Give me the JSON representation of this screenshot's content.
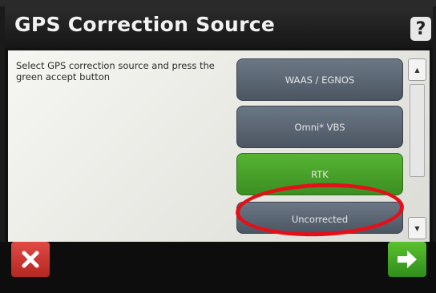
{
  "header": {
    "title": "GPS Correction Source",
    "help_label": "?"
  },
  "instructions": "Select GPS correction source and press the green accept button",
  "options": [
    {
      "label": "WAAS / EGNOS"
    },
    {
      "label": "Omni* VBS"
    },
    {
      "label": "RTK",
      "selected": true
    },
    {
      "label": "Uncorrected"
    }
  ],
  "colors": {
    "selected": "#4aa82b",
    "option": "#5b6572",
    "highlight_circle": "#e3101a",
    "cancel": "#c9302a",
    "accept": "#43a52a"
  },
  "icons": {
    "cancel": "close-icon",
    "accept": "arrow-right-icon",
    "scroll_up": "chevron-up-icon",
    "scroll_down": "chevron-down-icon"
  }
}
